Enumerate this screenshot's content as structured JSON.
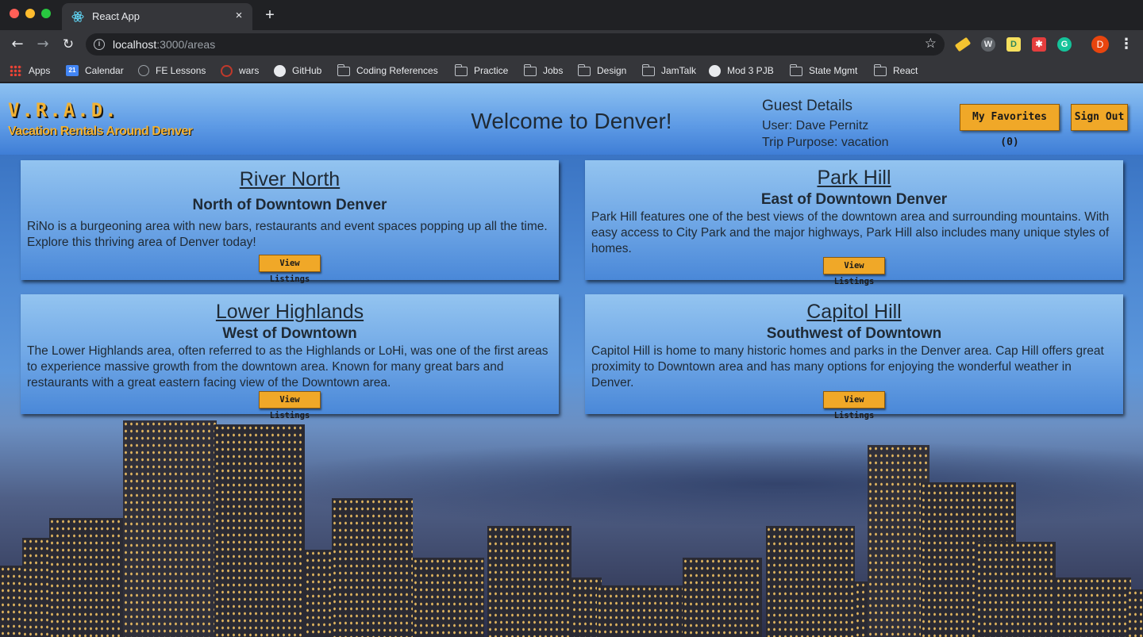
{
  "browser": {
    "tab_title": "React App",
    "tab_close": "×",
    "new_tab": "+",
    "url_host": "localhost",
    "url_path": ":3000/areas",
    "profile_initial": "D",
    "bookmarks": [
      {
        "label": "Apps",
        "icon": "apps-icon"
      },
      {
        "label": "Calendar",
        "icon": "calendar-icon",
        "badge": "21"
      },
      {
        "label": "FE Lessons",
        "icon": "lessons-icon"
      },
      {
        "label": "wars",
        "icon": "codewars-icon"
      },
      {
        "label": "GitHub",
        "icon": "github-icon"
      },
      {
        "label": "Coding References",
        "icon": "folder-icon"
      },
      {
        "label": "Practice",
        "icon": "folder-icon"
      },
      {
        "label": "Jobs",
        "icon": "folder-icon"
      },
      {
        "label": "Design",
        "icon": "folder-icon"
      },
      {
        "label": "JamTalk",
        "icon": "folder-icon"
      },
      {
        "label": "Mod 3 PJB",
        "icon": "github-icon"
      },
      {
        "label": "State Mgmt",
        "icon": "folder-icon"
      },
      {
        "label": "React",
        "icon": "folder-icon"
      }
    ],
    "extensions": [
      {
        "name": "highlighter-icon",
        "glyph": ""
      },
      {
        "name": "vimeo-extension-icon",
        "glyph": "W"
      },
      {
        "name": "d-extension-icon",
        "glyph": "D"
      },
      {
        "name": "red-extension-icon",
        "glyph": "✱"
      },
      {
        "name": "grammarly-icon",
        "glyph": "G"
      }
    ]
  },
  "header": {
    "logo_title": "V.R.A.D.",
    "logo_subtitle": "Vacation Rentals Around Denver",
    "welcome": "Welcome to Denver!",
    "guest_title": "Guest Details",
    "guest_user": "User: Dave Pernitz",
    "guest_purpose": "Trip Purpose: vacation",
    "favorites_button": "My Favorites (0)",
    "signout_button": "Sign Out"
  },
  "areas": [
    {
      "name": "River North",
      "location": "North of Downtown Denver",
      "description": "RiNo is a burgeoning area with new bars, restaurants and event spaces popping up all the time. Explore this thriving area of Denver today!",
      "button": "View Listings"
    },
    {
      "name": "Park Hill",
      "location": "East of Downtown Denver",
      "description": "Park Hill features one of the best views of the downtown area and surrounding mountains. With easy access to City Park and the major highways, Park Hill also includes many unique styles of homes.",
      "button": "View Listings"
    },
    {
      "name": "Lower Highlands",
      "location": "West of Downtown",
      "description": "The Lower Highlands area, often referred to as the Highlands or LoHi, was one of the first areas to experience massive growth from the downtown area. Known for many great bars and restaurants with a great eastern facing view of the Downtown area.",
      "button": "View Listings"
    },
    {
      "name": "Capitol Hill",
      "location": "Southwest of Downtown",
      "description": "Capitol Hill is home to many historic homes and parks in the Denver area. Cap Hill offers great proximity to Downtown area and has many options for enjoying the wonderful weather in Denver.",
      "button": "View Listings"
    }
  ],
  "colors": {
    "accent_button": "#f0a828",
    "logo": "#f2b233",
    "card_top": "#93c4f0",
    "card_bottom": "#4a88d8"
  }
}
